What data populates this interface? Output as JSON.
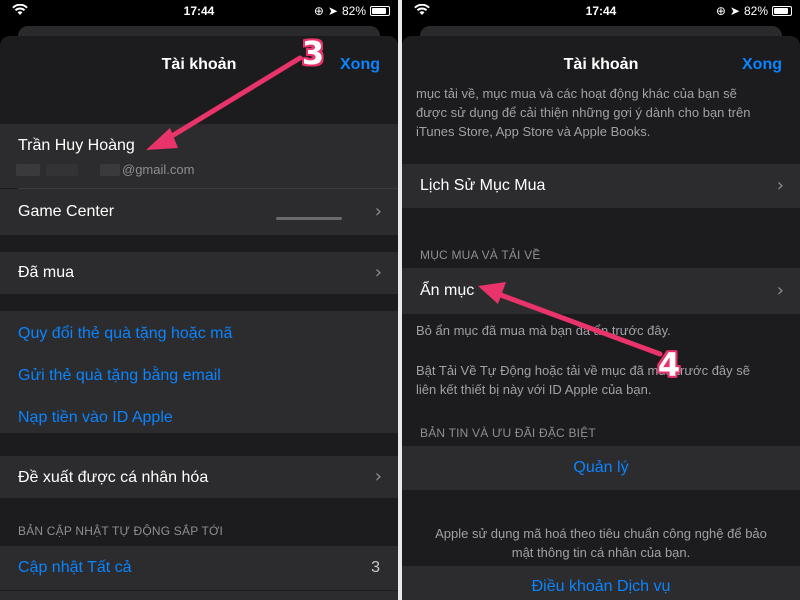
{
  "colors": {
    "accent": "#0a84ff",
    "annotation": "#e8336b",
    "sheet_bg": "#1c1c1e",
    "cell_bg": "#2c2c2e"
  },
  "status": {
    "time": "17:44",
    "battery": "82%"
  },
  "left": {
    "nav_title": "Tài khoản",
    "nav_done": "Xong",
    "user_name": "Trần Huy Hoàng",
    "email_suffix": "@gmail.com",
    "game_center": "Game Center",
    "purchased": "Đã mua",
    "links": [
      "Quy đổi thẻ quà tặng hoặc mã",
      "Gửi thẻ quà tặng bằng email",
      "Nạp tiền vào ID Apple"
    ],
    "personalized": "Đề xuất được cá nhân hóa",
    "updates_header": "BẢN CẬP NHẬT TỰ ĐỘNG SẮP TỚI",
    "update_all": "Cập nhật Tất cả",
    "update_count": "3",
    "annotation": "3"
  },
  "right": {
    "nav_title": "Tài khoản",
    "nav_done": "Xong",
    "top_text_1": "mục tải về, mục mua và các hoạt động khác của bạn sẽ",
    "top_text_2": "được sử dụng để cải thiện những gợi ý dành cho bạn trên",
    "top_text_3": "iTunes Store, App Store và Apple Books.",
    "purchase_history": "Lịch Sử Mục Mua",
    "section_purchases": "MỤC MUA VÀ TẢI VỀ",
    "hidden_items": "Ẩn mục",
    "hidden_note": "Bỏ ẩn mục đã mua mà bạn đã ẩn trước đây.",
    "auto_dl_note_1": "Bật Tải Về Tự Động hoặc tải về mục đã mua trước đây sẽ",
    "auto_dl_note_2": "liên kết thiết bị này với ID Apple của bạn.",
    "section_news": "BẢN TIN VÀ ƯU ĐÃI ĐẶC BIỆT",
    "manage": "Quản lý",
    "privacy_1": "Apple sử dụng mã hoá theo tiêu chuẩn công nghệ để bảo",
    "privacy_2": "mật thông tin cá nhân của bạn.",
    "terms": "Điều khoản Dịch vụ",
    "annotation": "4"
  }
}
